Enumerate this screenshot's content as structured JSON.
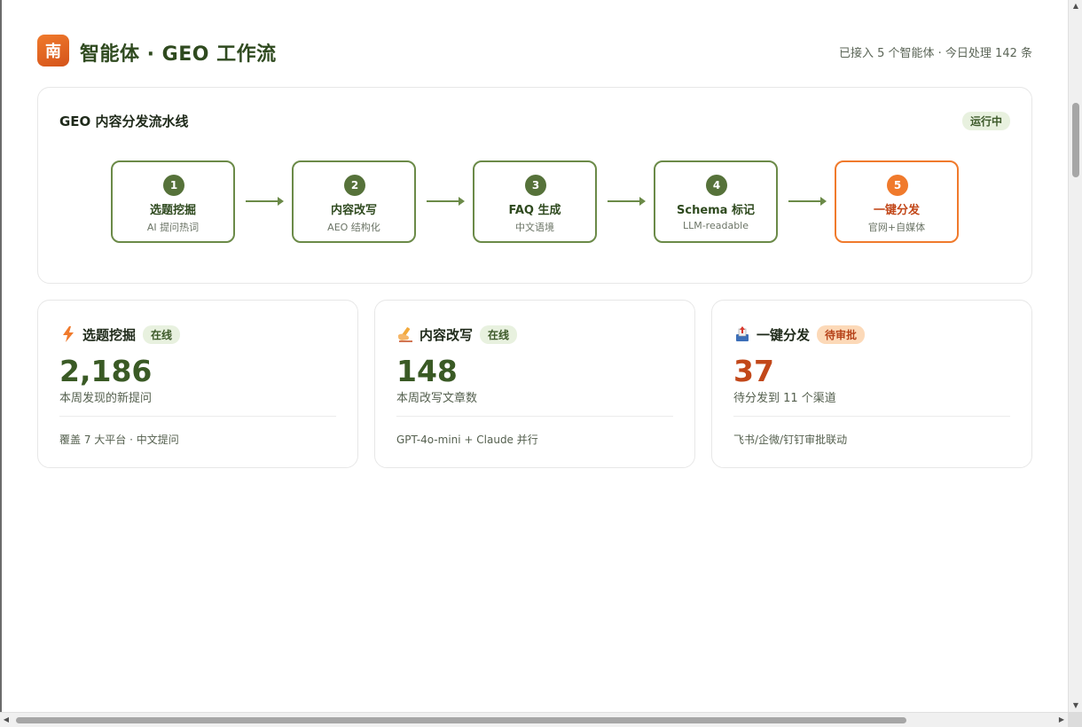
{
  "header": {
    "logo_char": "南",
    "title": "智能体 · GEO 工作流",
    "stats": "已接入 5 个智能体 · 今日处理 142 条"
  },
  "pipeline": {
    "title": "GEO 内容分发流水线",
    "status": "运行中",
    "steps": [
      {
        "num": "1",
        "name": "选题挖掘",
        "sub": "AI 提问热词"
      },
      {
        "num": "2",
        "name": "内容改写",
        "sub": "AEO 结构化"
      },
      {
        "num": "3",
        "name": "FAQ 生成",
        "sub": "中文语境"
      },
      {
        "num": "4",
        "name": "Schema 标记",
        "sub": "LLM-readable"
      },
      {
        "num": "5",
        "name": "一键分发",
        "sub": "官网+自媒体"
      }
    ]
  },
  "cards": [
    {
      "icon": "lightning-icon",
      "title": "选题挖掘",
      "badge": "在线",
      "value": "2,186",
      "desc": "本周发现的新提问",
      "foot": "覆盖 7 大平台 · 中文提问"
    },
    {
      "icon": "writing-hand-icon",
      "title": "内容改写",
      "badge": "在线",
      "value": "148",
      "desc": "本周改写文章数",
      "foot": "GPT-4o-mini + Claude 并行"
    },
    {
      "icon": "outbox-icon",
      "title": "一键分发",
      "badge": "待审批",
      "value": "37",
      "desc": "待分发到 11 个渠道",
      "foot": "飞书/企微/钉钉审批联动"
    }
  ],
  "colors": {
    "primary_green": "#3a5a25",
    "accent_orange": "#f07a2c",
    "badge_green_bg": "#e8f1df",
    "badge_orange_bg": "#fcd9b8"
  }
}
